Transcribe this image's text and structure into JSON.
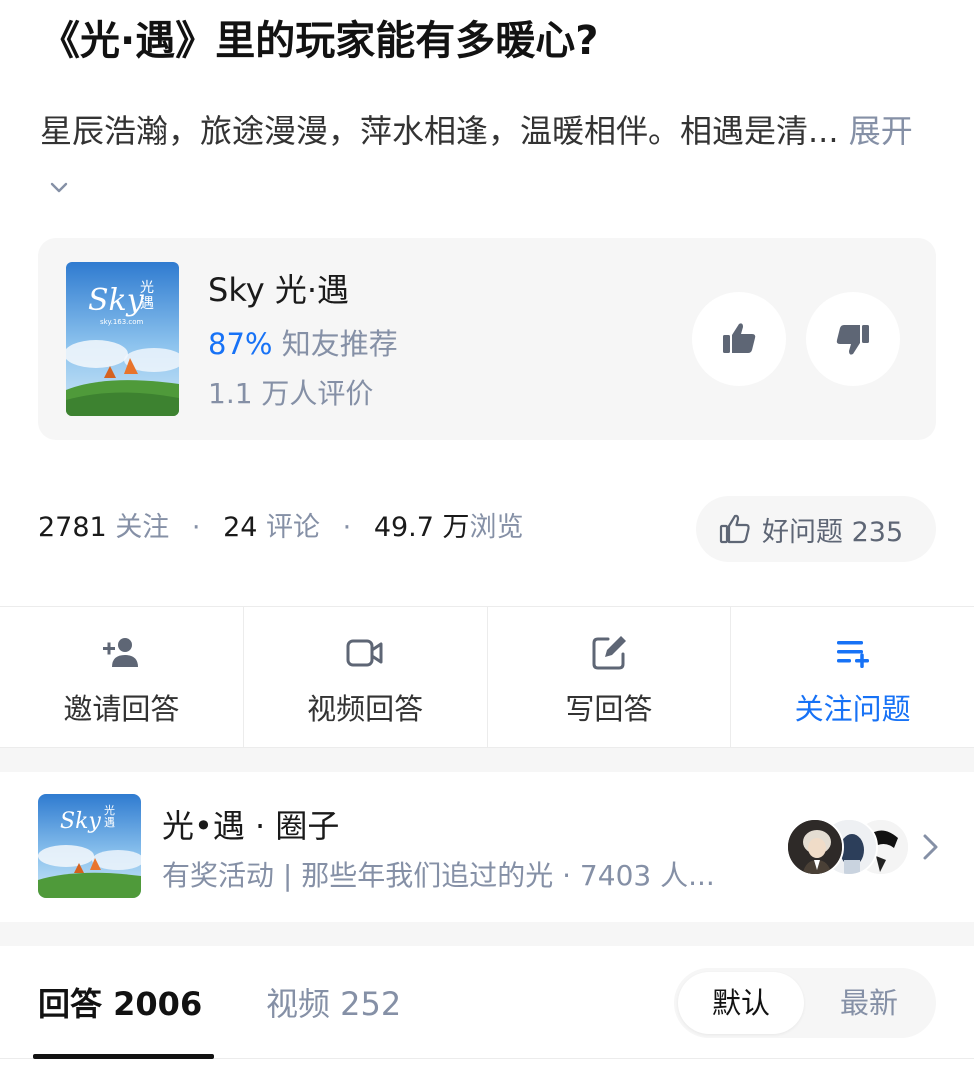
{
  "question": {
    "title": "《光·遇》里的玩家能有多暖心?",
    "description": "星辰浩瀚，旅途漫漫，萍水相逢，温暖相伴。相遇是清...",
    "expand_label": "展开"
  },
  "game_card": {
    "name": "Sky 光·遇",
    "recommend_percent": "87%",
    "recommend_label": "知友推荐",
    "rating_count": "1.1 万人评价",
    "cover_text": "Sky 光遇",
    "cover_url_text": "sky.163.com"
  },
  "stats": {
    "followers": "2781",
    "followers_label": "关注",
    "comments": "24",
    "comments_label": "评论",
    "views": "49.7 万",
    "views_label": "浏览",
    "good_question_label": "好问题 235"
  },
  "actions": [
    {
      "label": "邀请回答",
      "icon": "add-person-icon"
    },
    {
      "label": "视频回答",
      "icon": "video-camera-icon"
    },
    {
      "label": "写回答",
      "icon": "edit-icon"
    },
    {
      "label": "关注问题",
      "icon": "add-to-list-icon"
    }
  ],
  "circle": {
    "name": "光•遇 · 圈子",
    "subtitle": "有奖活动 | 那些年我们追过的光 · 7403 人..."
  },
  "tabs": {
    "answers": "回答 2006",
    "videos": "视频 252"
  },
  "sort": {
    "default": "默认",
    "latest": "最新"
  },
  "colors": {
    "accent_blue": "#1772f6",
    "muted_gray": "#8590a6",
    "card_bg": "#f6f6f6"
  }
}
